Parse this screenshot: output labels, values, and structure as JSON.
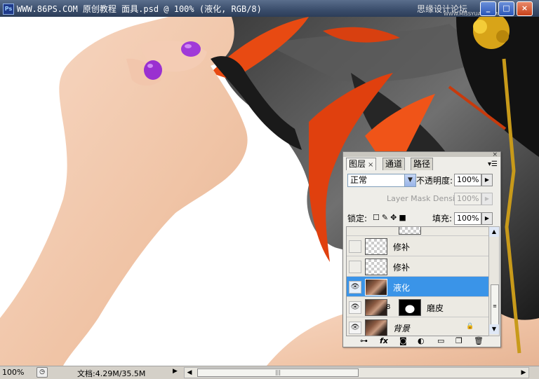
{
  "window": {
    "title": "WWW.86PS.COM 原创教程 面具.psd @ 100% (液化, RGB/8)",
    "app_icon": "Ps",
    "watermark": "思缘设计论坛",
    "watermark_sub": "WWW.MISSYUAN.COM",
    "minimize": "_",
    "maximize": "□",
    "close": "×"
  },
  "status": {
    "zoom": "100%",
    "doc_info": "文档:4.29M/35.5M",
    "scroll_grip": "|||"
  },
  "layers_panel": {
    "tabs": [
      {
        "label": "图层",
        "close": "×"
      },
      {
        "label": "通道"
      },
      {
        "label": "路径"
      }
    ],
    "panel_close": "×",
    "blend_mode": "正常",
    "opacity_label": "不透明度:",
    "opacity": "100%",
    "mask_density_label": "Layer Mask Density",
    "mask_density": "100%",
    "lock_label": "锁定:",
    "fill_label": "填充:",
    "fill": "100%",
    "layers": [
      {
        "name": "修补",
        "visible": false
      },
      {
        "name": "修补",
        "visible": false
      },
      {
        "name": "液化",
        "visible": true,
        "selected": true
      },
      {
        "name": "磨皮",
        "visible": true,
        "has_mask": true
      },
      {
        "name": "背景",
        "visible": true,
        "locked": true
      }
    ],
    "bottom_icons": [
      "link-icon",
      "fx-icon",
      "mask-icon",
      "adjustment-icon",
      "folder-icon",
      "new-layer-icon",
      "trash-icon"
    ]
  },
  "colors": {
    "selection": "#3a94e8",
    "titlebar": "#3a4d6b",
    "feather_orange": "#e84a12",
    "skin": "#f2c8ac",
    "nail": "#a03ad8"
  }
}
